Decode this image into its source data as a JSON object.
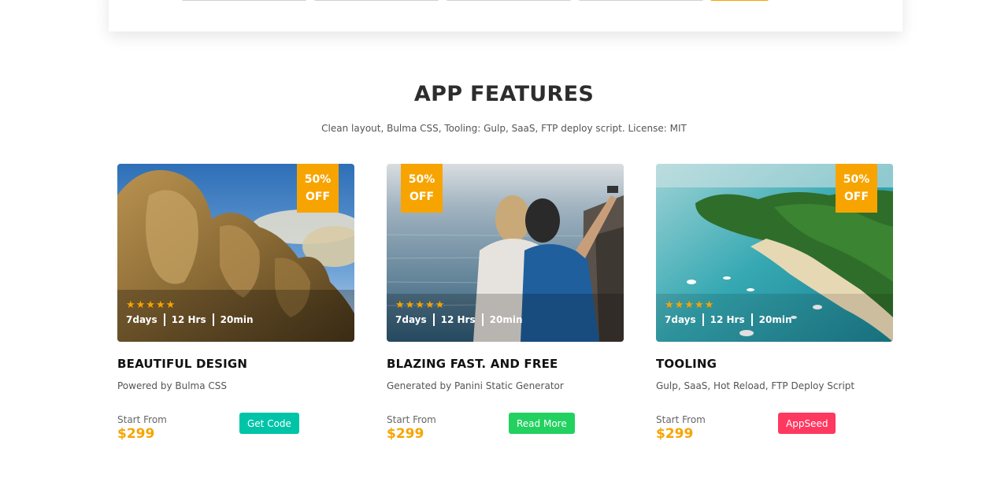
{
  "section": {
    "title": "APP FEATURES",
    "subtitle": "Clean layout, Bulma CSS, Tooling: Gulp, SaaS, FTP deploy script. License: MIT"
  },
  "cards": [
    {
      "discount_line1": "50%",
      "discount_line2": "OFF",
      "rating": "★★★★★",
      "meta": [
        "7days",
        "12 Hrs",
        "20min"
      ],
      "title": "BEAUTIFUL DESIGN",
      "desc": "Powered by Bulma CSS",
      "start_label": "Start From",
      "price": "$299",
      "button_label": "Get Code",
      "button_color": "#00c4a7"
    },
    {
      "discount_line1": "50%",
      "discount_line2": "OFF",
      "rating": "★★★★★",
      "meta": [
        "7days",
        "12 Hrs",
        "20min"
      ],
      "title": "BLAZING FAST. AND FREE",
      "desc": "Generated by Panini Static Generator",
      "start_label": "Start From",
      "price": "$299",
      "button_label": "Read More",
      "button_color": "#23d160"
    },
    {
      "discount_line1": "50%",
      "discount_line2": "OFF",
      "rating": "★★★★★",
      "meta": [
        "7days",
        "12 Hrs",
        "20min"
      ],
      "title": "TOOLING",
      "desc": "Gulp, SaaS, Hot Reload, FTP Deploy Script",
      "start_label": "Start From",
      "price": "$299",
      "button_label": "AppSeed",
      "button_color": "#ff3860"
    }
  ],
  "colors": {
    "accent": "#f7a400",
    "title": "#2d2d2d"
  }
}
